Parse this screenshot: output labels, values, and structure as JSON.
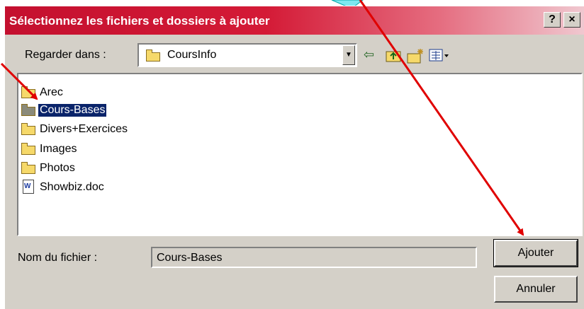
{
  "dialog": {
    "title": "Sélectionnez les fichiers et dossiers à ajouter",
    "help_label": "?",
    "close_label": "×"
  },
  "lookin": {
    "label": "Regarder dans :",
    "value": "CoursInfo"
  },
  "toolbar": {
    "back_icon": "⇦",
    "up_icon": "up-folder-icon",
    "new_folder_icon": "new-folder-icon",
    "view_icon": "view-menu-icon"
  },
  "files": [
    {
      "name": "Arec",
      "type": "folder",
      "selected": false
    },
    {
      "name": "Cours-Bases",
      "type": "folder",
      "selected": true
    },
    {
      "name": "Divers+Exercices",
      "type": "folder",
      "selected": false
    },
    {
      "name": "Images",
      "type": "folder",
      "selected": false
    },
    {
      "name": "Photos",
      "type": "folder",
      "selected": false
    },
    {
      "name": "Showbiz.doc",
      "type": "doc",
      "selected": false
    }
  ],
  "filename": {
    "label": "Nom du fichier :",
    "value": "Cours-Bases"
  },
  "buttons": {
    "add": "Ajouter",
    "cancel": "Annuler"
  },
  "colors": {
    "title_start": "#c4102f",
    "selection": "#0a246a",
    "annotation": "#e00000",
    "callout": "#7ee8f0"
  }
}
